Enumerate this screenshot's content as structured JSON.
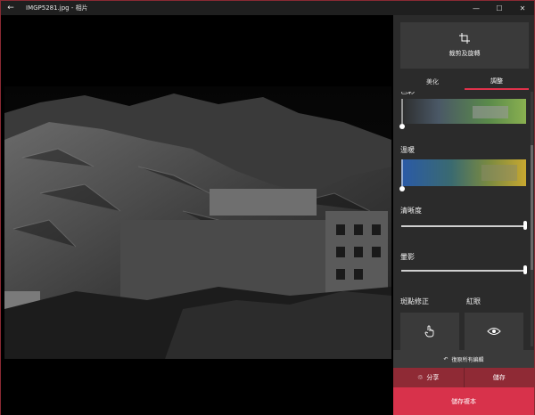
{
  "window": {
    "title": "IMGP5281.jpg - 相片"
  },
  "panel": {
    "crop_label": "裁剪及旋轉",
    "tabs": [
      "美化",
      "調整"
    ],
    "sections": {
      "color_label": "色彩",
      "warmth_label": "溫暖",
      "clarity_label": "清晰度",
      "vignette_label": "暈影",
      "spot_fix_label": "斑點修正",
      "red_eye_label": "紅眼"
    },
    "revert_label": "復原所有編輯",
    "share_label": "分享",
    "save_label": "儲存",
    "save_copy_label": "儲存複本"
  },
  "colors": {
    "accent": "#d8324b",
    "action_bar": "#8f2a35",
    "panel_bg": "#2b2b2b"
  }
}
